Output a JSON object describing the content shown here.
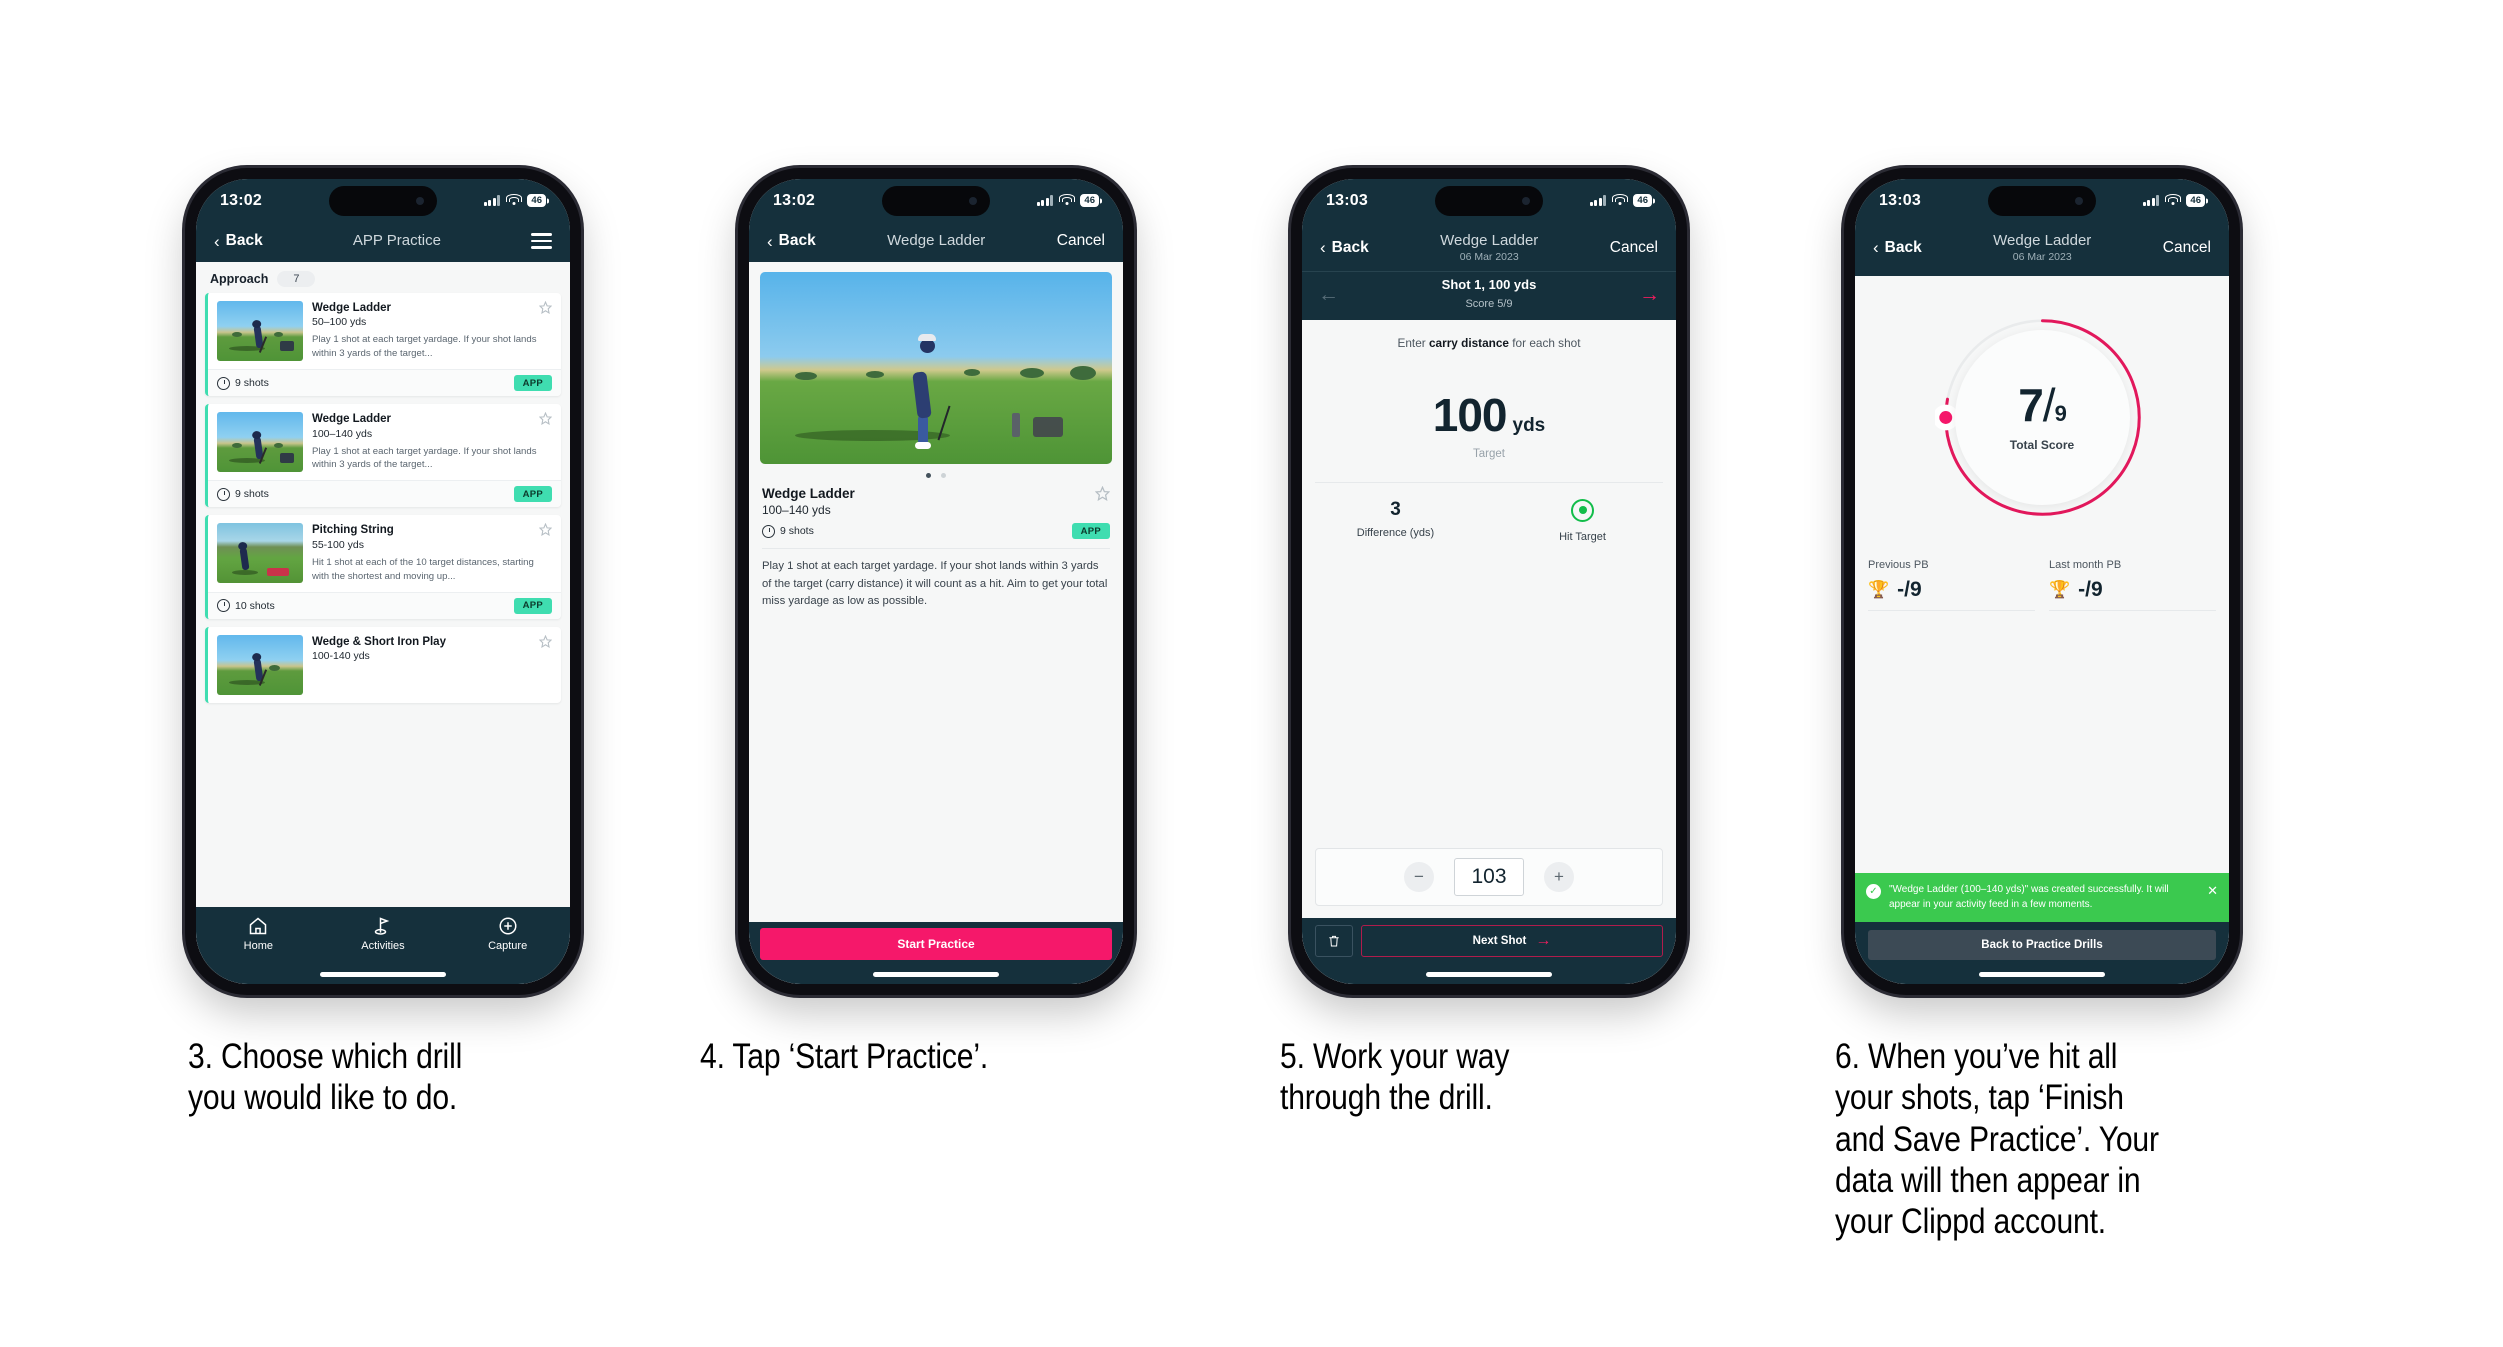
{
  "phones": [
    {
      "status": {
        "time": "13:02",
        "battery": "46"
      },
      "nav": {
        "back": "Back",
        "title": "APP Practice",
        "menu_icon": "hamburger-icon"
      },
      "category": {
        "label": "Approach",
        "count": "7"
      },
      "cards": [
        {
          "title": "Wedge Ladder",
          "yards": "50–100 yds",
          "desc": "Play 1 shot at each target yardage. If your shot lands within 3 yards of the target...",
          "shots": "9 shots",
          "badge": "APP"
        },
        {
          "title": "Wedge Ladder",
          "yards": "100–140 yds",
          "desc": "Play 1 shot at each target yardage. If your shot lands within 3 yards of the target...",
          "shots": "9 shots",
          "badge": "APP"
        },
        {
          "title": "Pitching String",
          "yards": "55-100 yds",
          "desc": "Hit 1 shot at each of the 10 target distances, starting with the shortest and moving up...",
          "shots": "10 shots",
          "badge": "APP"
        },
        {
          "title": "Wedge & Short Iron Play",
          "yards": "100-140 yds",
          "desc": "",
          "shots": "",
          "badge": ""
        }
      ],
      "tabs": [
        {
          "label": "Home",
          "icon": "home-icon"
        },
        {
          "label": "Activities",
          "icon": "golf-flag-icon"
        },
        {
          "label": "Capture",
          "icon": "plus-circle-icon"
        }
      ]
    },
    {
      "status": {
        "time": "13:02",
        "battery": "46"
      },
      "nav": {
        "back": "Back",
        "title": "Wedge Ladder",
        "cancel": "Cancel"
      },
      "drill": {
        "title": "Wedge Ladder",
        "yards": "100–140 yds",
        "shots": "9 shots",
        "badge": "APP",
        "description": "Play 1 shot at each target yardage. If your shot lands within 3 yards of the target (carry distance) it will count as a hit. Aim to get your total miss yardage as low as possible."
      },
      "cta": "Start Practice"
    },
    {
      "status": {
        "time": "13:03",
        "battery": "46"
      },
      "nav": {
        "back": "Back",
        "title": "Wedge Ladder",
        "subtitle": "06 Mar 2023",
        "cancel": "Cancel"
      },
      "subnav": {
        "shot": "Shot 1, 100 yds",
        "score": "Score 5/9"
      },
      "prompt_pre": "Enter ",
      "prompt_bold": "carry distance",
      "prompt_post": " for each shot",
      "target": {
        "value": "100",
        "unit": "yds",
        "label": "Target"
      },
      "stats": [
        {
          "value": "3",
          "label": "Difference (yds)"
        },
        {
          "value": "",
          "label": "Hit Target",
          "icon": "target-hit-icon"
        }
      ],
      "stepper": {
        "minus": "−",
        "value": "103",
        "plus": "+"
      },
      "footer": {
        "delete_icon": "trash-icon",
        "next": "Next Shot"
      }
    },
    {
      "status": {
        "time": "13:03",
        "battery": "46"
      },
      "nav": {
        "back": "Back",
        "title": "Wedge Ladder",
        "subtitle": "06 Mar 2023",
        "cancel": "Cancel"
      },
      "result": {
        "score": "7",
        "slash": "/",
        "total": "9",
        "label": "Total Score",
        "progress_pct": 78
      },
      "pbs": [
        {
          "title": "Previous PB",
          "value": "-/9",
          "icon": "trophy-icon"
        },
        {
          "title": "Last month PB",
          "value": "-/9",
          "icon": "trophy-icon"
        }
      ],
      "toast": {
        "message": "\"Wedge Ladder (100–140 yds)\" was created successfully. It will appear in your activity feed in a few moments.",
        "check_icon": "check-circle-icon",
        "close_icon": "close-icon"
      },
      "button": "Back to Practice Drills"
    }
  ],
  "captions": [
    "3. Choose which drill you would like to do.",
    "4. Tap ‘Start Practice’.",
    "5. Work your way through the drill.",
    "6. When you’ve hit all your shots, tap ‘Finish and Save Practice’. Your data will then appear in your Clippd account."
  ],
  "colors": {
    "navy": "#15303c",
    "pink": "#f5186a",
    "mint": "#3fddb0",
    "green": "#3bc94f",
    "ring_green": "#12bd4a"
  }
}
